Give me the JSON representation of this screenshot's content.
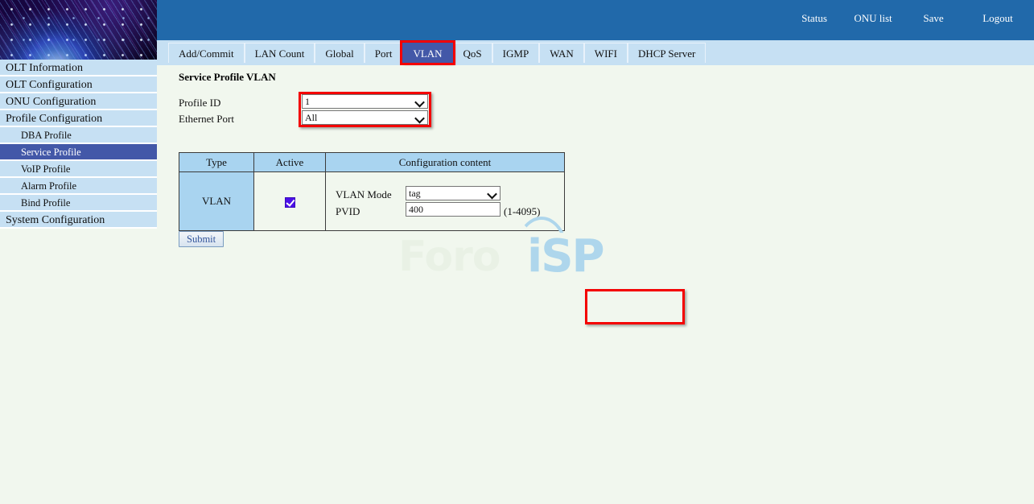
{
  "header": {
    "links": [
      {
        "label": "Status",
        "name": "header-link-status"
      },
      {
        "label": "ONU list",
        "name": "header-link-onu-list"
      },
      {
        "label": "Save",
        "name": "header-link-save"
      },
      {
        "label": "Logout",
        "name": "header-link-logout"
      }
    ],
    "banner_icon": "fiber-globe-banner"
  },
  "sidebar": {
    "items": [
      {
        "label": "OLT Information",
        "level": 0,
        "selected": false
      },
      {
        "label": "OLT Configuration",
        "level": 0,
        "selected": false
      },
      {
        "label": "ONU Configuration",
        "level": 0,
        "selected": false
      },
      {
        "label": "Profile Configuration",
        "level": 0,
        "selected": false
      },
      {
        "label": "DBA Profile",
        "level": 1,
        "selected": false
      },
      {
        "label": "Service Profile",
        "level": 1,
        "selected": true
      },
      {
        "label": "VoIP Profile",
        "level": 1,
        "selected": false
      },
      {
        "label": "Alarm Profile",
        "level": 1,
        "selected": false
      },
      {
        "label": "Bind Profile",
        "level": 1,
        "selected": false
      },
      {
        "label": "System Configuration",
        "level": 0,
        "selected": false
      }
    ]
  },
  "tabs": [
    {
      "label": "Add/Commit",
      "active": false,
      "highlighted": false
    },
    {
      "label": "LAN Count",
      "active": false,
      "highlighted": false
    },
    {
      "label": "Global",
      "active": false,
      "highlighted": false
    },
    {
      "label": "Port",
      "active": false,
      "highlighted": false
    },
    {
      "label": "VLAN",
      "active": true,
      "highlighted": true
    },
    {
      "label": "QoS",
      "active": false,
      "highlighted": false
    },
    {
      "label": "IGMP",
      "active": false,
      "highlighted": false
    },
    {
      "label": "WAN",
      "active": false,
      "highlighted": false
    },
    {
      "label": "WIFI",
      "active": false,
      "highlighted": false
    },
    {
      "label": "DHCP Server",
      "active": false,
      "highlighted": false
    }
  ],
  "main": {
    "title": "Service Profile VLAN",
    "form": {
      "profile_id_label": "Profile ID",
      "profile_id_value": "1",
      "ethernet_port_label": "Ethernet Port",
      "ethernet_port_value": "All"
    },
    "table": {
      "headers": [
        "Type",
        "Active",
        "Configuration content"
      ],
      "row": {
        "type": "VLAN",
        "active": true,
        "vlan_mode_label": "VLAN Mode",
        "vlan_mode_value": "tag",
        "pvid_label": "PVID",
        "pvid_value": "400",
        "pvid_hint": "(1-4095)"
      }
    },
    "submit_label": "Submit"
  },
  "watermark": {
    "text_left": "Foro",
    "text_right": "iSP"
  },
  "colors": {
    "header_blue": "#2169aa",
    "sidebar_blue": "#c6e0f3",
    "sidebar_selected": "#4358a8",
    "tab_active": "#4358a8",
    "annotation_red": "#f40000",
    "table_header_blue": "#a9d4f0",
    "page_background": "#f1f7ee",
    "checkbox_purple": "#4b10e8"
  }
}
